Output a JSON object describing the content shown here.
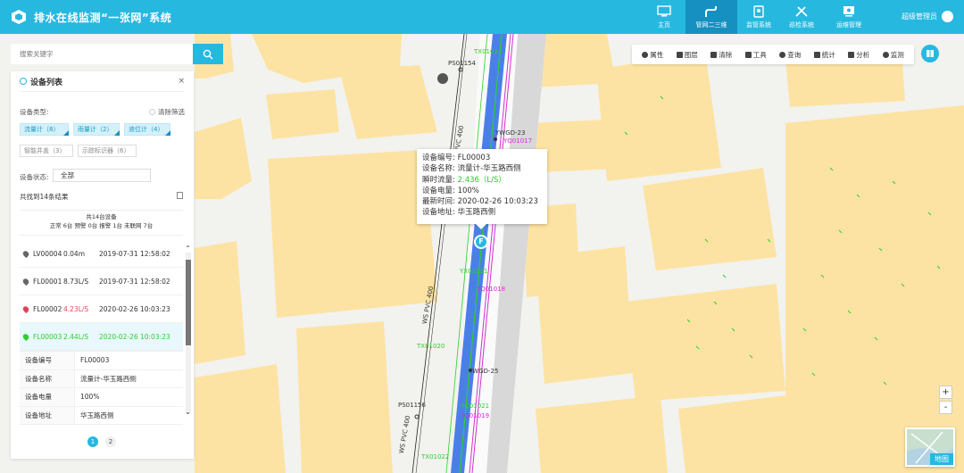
{
  "app": {
    "title": "排水在线监测“一张网”系统"
  },
  "nav": [
    {
      "label": "主页",
      "icon": "monitor-icon"
    },
    {
      "label": "管网二三维",
      "icon": "pipe-icon"
    },
    {
      "label": "监管系统",
      "icon": "shield-icon"
    },
    {
      "label": "巡检系统",
      "icon": "tools-icon"
    },
    {
      "label": "运维管理",
      "icon": "screen-gear-icon"
    }
  ],
  "user": {
    "name": "超级管理员"
  },
  "search": {
    "placeholder": "搜索关键字"
  },
  "toolbar": [
    "属性",
    "图层",
    "清除",
    "工具",
    "查询",
    "统计",
    "分析",
    "监测"
  ],
  "panel": {
    "title": "设备列表",
    "close": "×",
    "type_label": "设备类型:",
    "clear_label": "清除筛选",
    "types_active": [
      "流量计（8）",
      "雨量计（2）",
      "液位计（4）"
    ],
    "types_inactive": [
      "智能井盖（3）",
      "示踪标识器（6）"
    ],
    "status_label": "设备状态:",
    "status_value": "全部",
    "result_text": "共找到14条结果",
    "summary_line1": "共14台设备",
    "summary_line2": "正常 6台   预警 0台   报警 1台   未联网 7台",
    "devices": [
      {
        "id": "LV00004",
        "value": "0.04m",
        "time": "2019-07-31 12:58:02",
        "color": "#666666"
      },
      {
        "id": "FL00001",
        "value": "8.73L/S",
        "time": "2019-07-31 12:58:02",
        "color": "#666666"
      },
      {
        "id": "FL00002",
        "value": "4.23L/S",
        "time": "2020-02-26 10:03:23",
        "color": "#e0445a"
      },
      {
        "id": "FL00003",
        "value": "2.44L/S",
        "time": "2020-02-26 10:03:23",
        "color": "#2ad12a"
      }
    ],
    "detail": [
      {
        "k": "设备编号",
        "v": "FL00003"
      },
      {
        "k": "设备名称",
        "v": "流量计-华玉路西侧"
      },
      {
        "k": "设备电量",
        "v": "100%"
      },
      {
        "k": "设备地址",
        "v": "华玉路西侧"
      }
    ],
    "pages": [
      "1",
      "2"
    ]
  },
  "popup": {
    "lines": [
      {
        "k": "设备编号:",
        "v": "FL00003"
      },
      {
        "k": "设备名称:",
        "v": "流量计-华玉路西侧"
      },
      {
        "k": "瞬时流量:",
        "v": "2.436（L/S）"
      },
      {
        "k": "设备电量:",
        "v": "100%"
      },
      {
        "k": "最新时间:",
        "v": "2020-02-26 10:03:23"
      },
      {
        "k": "设备地址:",
        "v": "华玉路西侧"
      }
    ]
  },
  "map": {
    "labels": {
      "ps154": "PS01154",
      "ps156": "PS01156",
      "ws1": "WS PVC 400",
      "ws2": "WS PVC 400",
      "ws3": "WS PVC 400",
      "ywgd23": "YWGD-23",
      "ywgd25": "YWGD-25",
      "yq17": "YQ01017",
      "yq18": "YQ01018",
      "yq19": "YQ01019",
      "yq21": "YQ01021",
      "tx20": "TX01020",
      "tx21": "TX01021",
      "tx22": "TX01022",
      "yx21": "YX01021",
      "marker_f": "F"
    },
    "basemap_label": "地图",
    "zoom_in": "+",
    "zoom_out": "-"
  },
  "colors": {
    "accent": "#27b8e0",
    "building": "#fde3a3",
    "pipe_blue": "#4b7fe8",
    "pipe_green": "#2ad12a",
    "pipe_magenta": "#d22fd2"
  }
}
